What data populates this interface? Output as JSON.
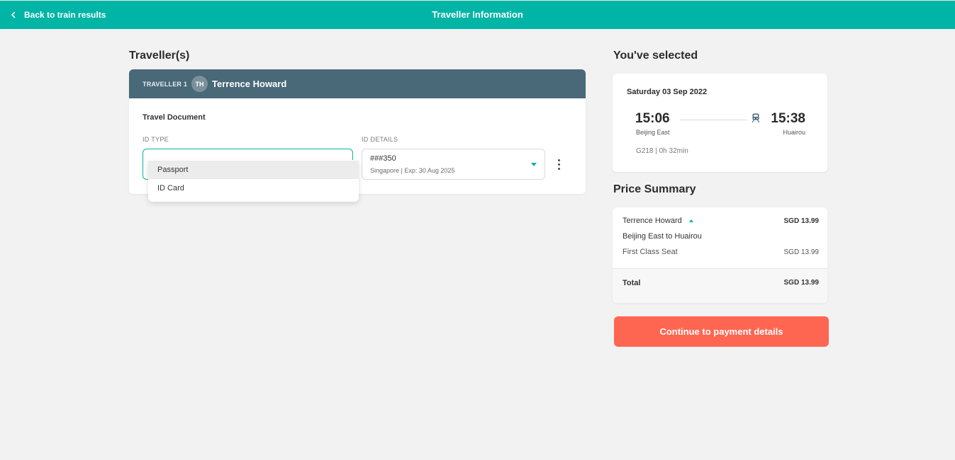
{
  "header": {
    "back_label": "Back to train results",
    "title": "Traveller Information",
    "back_icon": "chevron-left-icon"
  },
  "travellers_section": {
    "title": "Traveller(s)"
  },
  "traveller": {
    "tag": "TRAVELLER 1",
    "initials": "TH",
    "name": "Terrence Howard",
    "travel_document_title": "Travel Document",
    "id_type_label": "ID TYPE",
    "id_type_value": "",
    "id_details_label": "ID DETAILS",
    "id_number": "###350",
    "id_meta": "Singapore | Exp: 30 Aug 2025",
    "more_icon": "kebab-menu-icon"
  },
  "id_type_dropdown": {
    "options": [
      "Passport",
      "ID Card"
    ],
    "highlighted_index": 0
  },
  "selected_section": {
    "title": "You've selected"
  },
  "trip": {
    "date": "Saturday 03 Sep 2022",
    "departure_time": "15:06",
    "departure_station": "Beijing East",
    "arrival_time": "15:38",
    "arrival_station": "Huairou",
    "train_info": "G218 | 0h 32min",
    "train_icon": "train-icon"
  },
  "price_summary": {
    "title": "Price Summary",
    "traveller_name": "Terrence Howard",
    "traveller_amount": "SGD 13.99",
    "route": "Beijing East to Huairou",
    "seat_class": "First Class Seat",
    "seat_amount": "SGD 13.99",
    "total_label": "Total",
    "total_amount": "SGD 13.99"
  },
  "actions": {
    "continue_label": "Continue to payment details"
  },
  "colors": {
    "brand_teal": "#00b5a5",
    "traveller_header": "#496878",
    "cta": "#ff6652",
    "background": "#f2f2f2"
  }
}
